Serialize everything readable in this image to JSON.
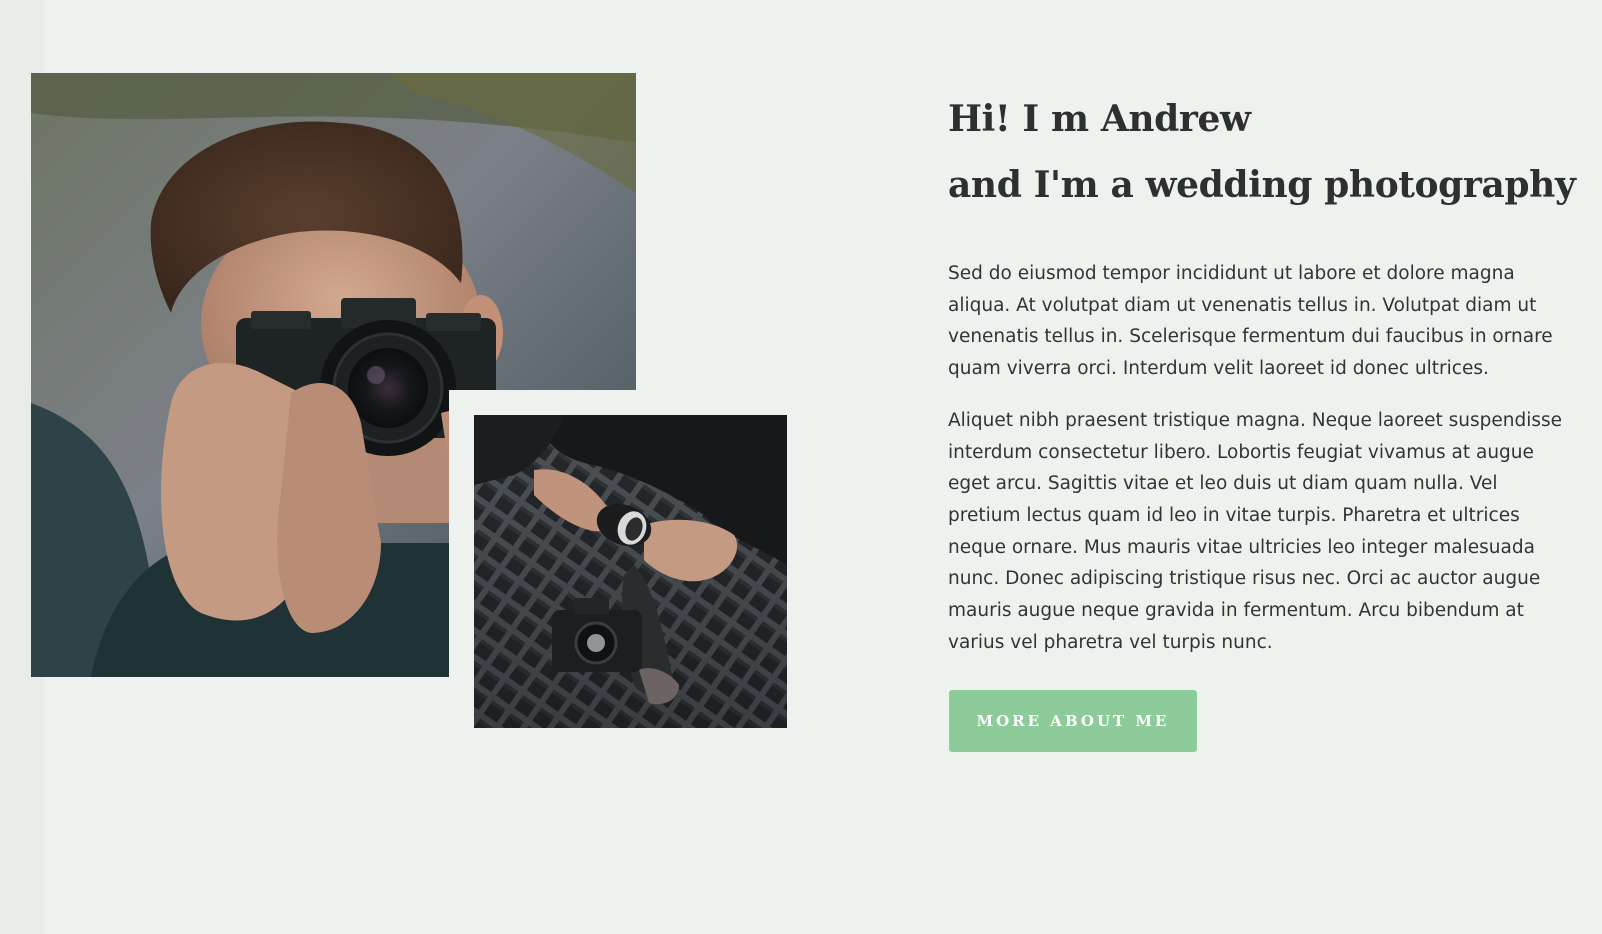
{
  "about": {
    "heading_line1": "Hi! I m Andrew",
    "heading_line2": "and I'm a wedding photography",
    "paragraph1": "Sed do eiusmod tempor incididunt ut labore et dolore magna aliqua. At volutpat diam ut venenatis tellus in. Volutpat diam ut venenatis tellus in. Scelerisque fermentum dui faucibus in ornare quam viverra orci. Interdum velit laoreet id donec ultrices.",
    "paragraph2": "Aliquet nibh praesent tristique magna. Neque laoreet suspendisse interdum consectetur libero. Lobortis feugiat vivamus at augue eget arcu. Sagittis vitae et leo duis ut diam quam nulla. Vel pretium lectus quam id leo in vitae turpis. Pharetra et ultrices neque ornare. Mus mauris vitae ultricies leo integer malesuada nunc. Donec adipiscing tristique risus nec. Orci ac auctor augue mauris augue neque gravida in fermentum. Arcu bibendum at varius vel pharetra vel turpis nunc.",
    "button_label": "MORE ABOUT ME"
  },
  "photos": {
    "main_icon": "photographer-with-camera-photo",
    "second_icon": "hands-holding-camera-lens-photo"
  },
  "colors": {
    "background": "#eef2ef",
    "heading": "#2f2f2f",
    "body_text": "#333333",
    "button": "#8ecb9a",
    "button_text": "#ffffff"
  }
}
